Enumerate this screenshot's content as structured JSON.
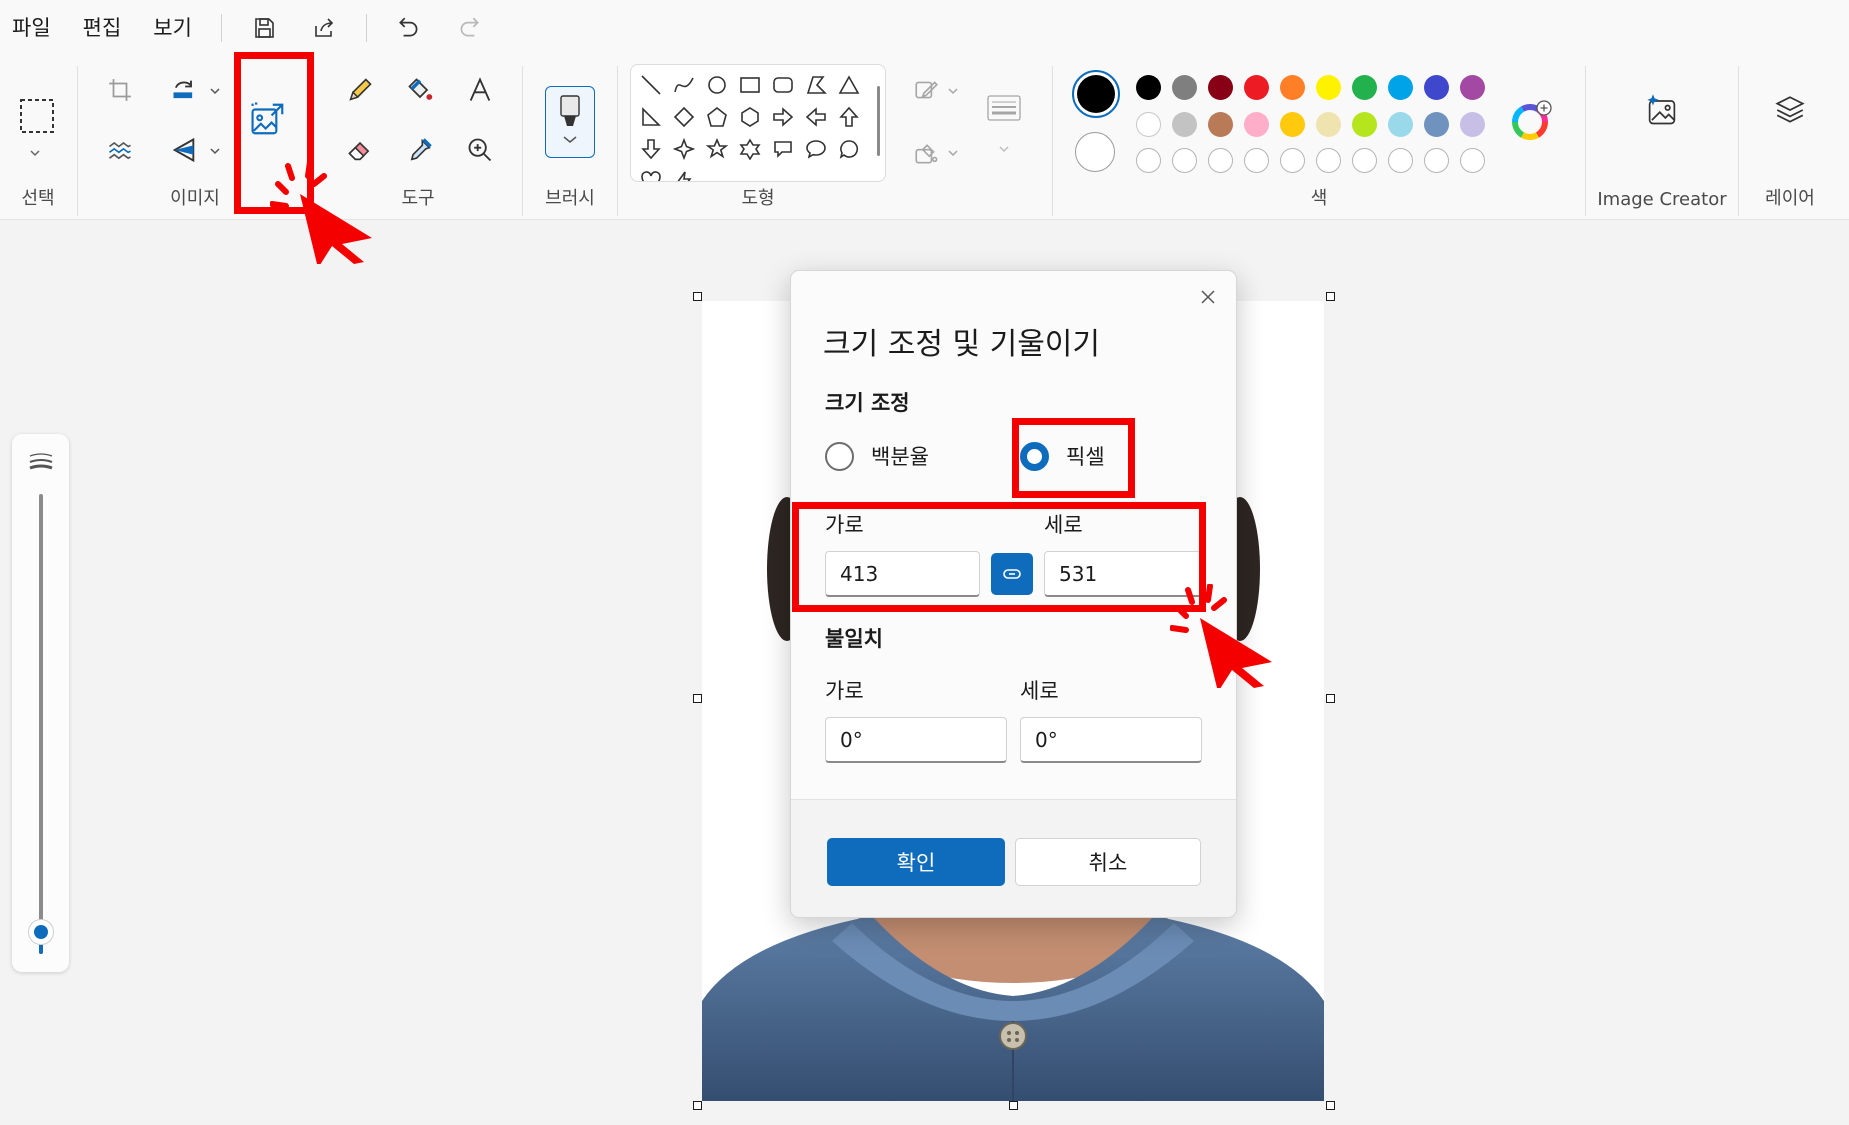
{
  "menu": {
    "items": [
      "파일",
      "편집",
      "보기"
    ]
  },
  "ribbon": {
    "groups": {
      "select": "선택",
      "image": "이미지",
      "tools": "도구",
      "brushes": "브러시",
      "shapes": "도형",
      "colors": "색",
      "image_creator": "Image Creator",
      "layers": "레이어"
    },
    "palette": {
      "current_primary": "#000000",
      "current_secondary": "#ffffff",
      "row1": [
        "#000000",
        "#7f7f7f",
        "#880015",
        "#ed1c24",
        "#ff7f27",
        "#fff200",
        "#22b14c",
        "#00a2e8",
        "#3f48cc",
        "#a349a4"
      ],
      "row2": [
        "#ffffff",
        "#c3c3c3",
        "#b97a57",
        "#ffaec9",
        "#ffc90e",
        "#efe4b0",
        "#b5e61d",
        "#99d9ea",
        "#7092be",
        "#c8bfe7"
      ]
    }
  },
  "dialog": {
    "title": "크기 조정 및 기울이기",
    "resize_label": "크기 조정",
    "radio_percent": "백분율",
    "radio_pixel": "픽셀",
    "selected_mode": "픽셀",
    "horizontal_label": "가로",
    "vertical_label": "세로",
    "width_value": "413",
    "height_value": "531",
    "skew_label": "불일치",
    "skew_horizontal_label": "가로",
    "skew_vertical_label": "세로",
    "skew_horizontal_value": "0°",
    "skew_vertical_value": "0°",
    "ok_label": "확인",
    "cancel_label": "취소"
  },
  "colors": {
    "accent": "#0f6cbd",
    "annotation": "#f40000"
  }
}
